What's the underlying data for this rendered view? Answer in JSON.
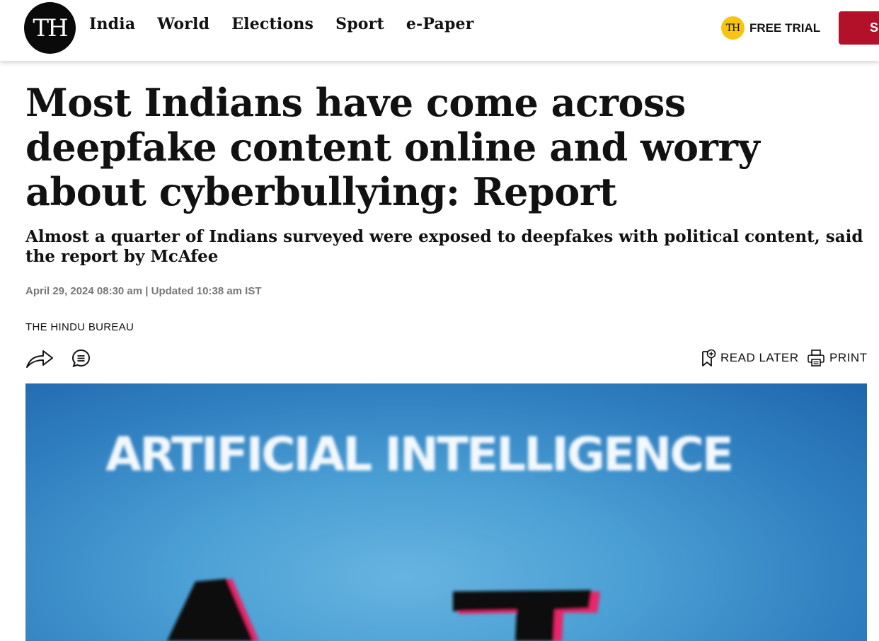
{
  "header": {
    "logo_text": "TH",
    "nav": [
      "India",
      "World",
      "Elections",
      "Sport",
      "e-Paper"
    ],
    "free_trial_badge": "TH",
    "free_trial_label": "FREE TRIAL",
    "subscribe_label": "SU"
  },
  "article": {
    "headline": "Most Indians have come across deepfake content online and worry about cyberbullying: Report",
    "subheadline": "Almost a quarter of Indians surveyed were exposed to deepfakes with political content, said the report by McAfee",
    "dateline": "April 29, 2024 08:30 am | Updated 10:38 am IST",
    "author": "THE HINDU BUREAU"
  },
  "actions": {
    "read_later": "READ LATER",
    "print": "PRINT"
  },
  "hero_image": {
    "text": "ARTIFICIAL INTELLIGENCE"
  },
  "colors": {
    "subscribe": "#b3102a",
    "badge": "#f7c412",
    "hero_blue": "#4a9fd4"
  }
}
